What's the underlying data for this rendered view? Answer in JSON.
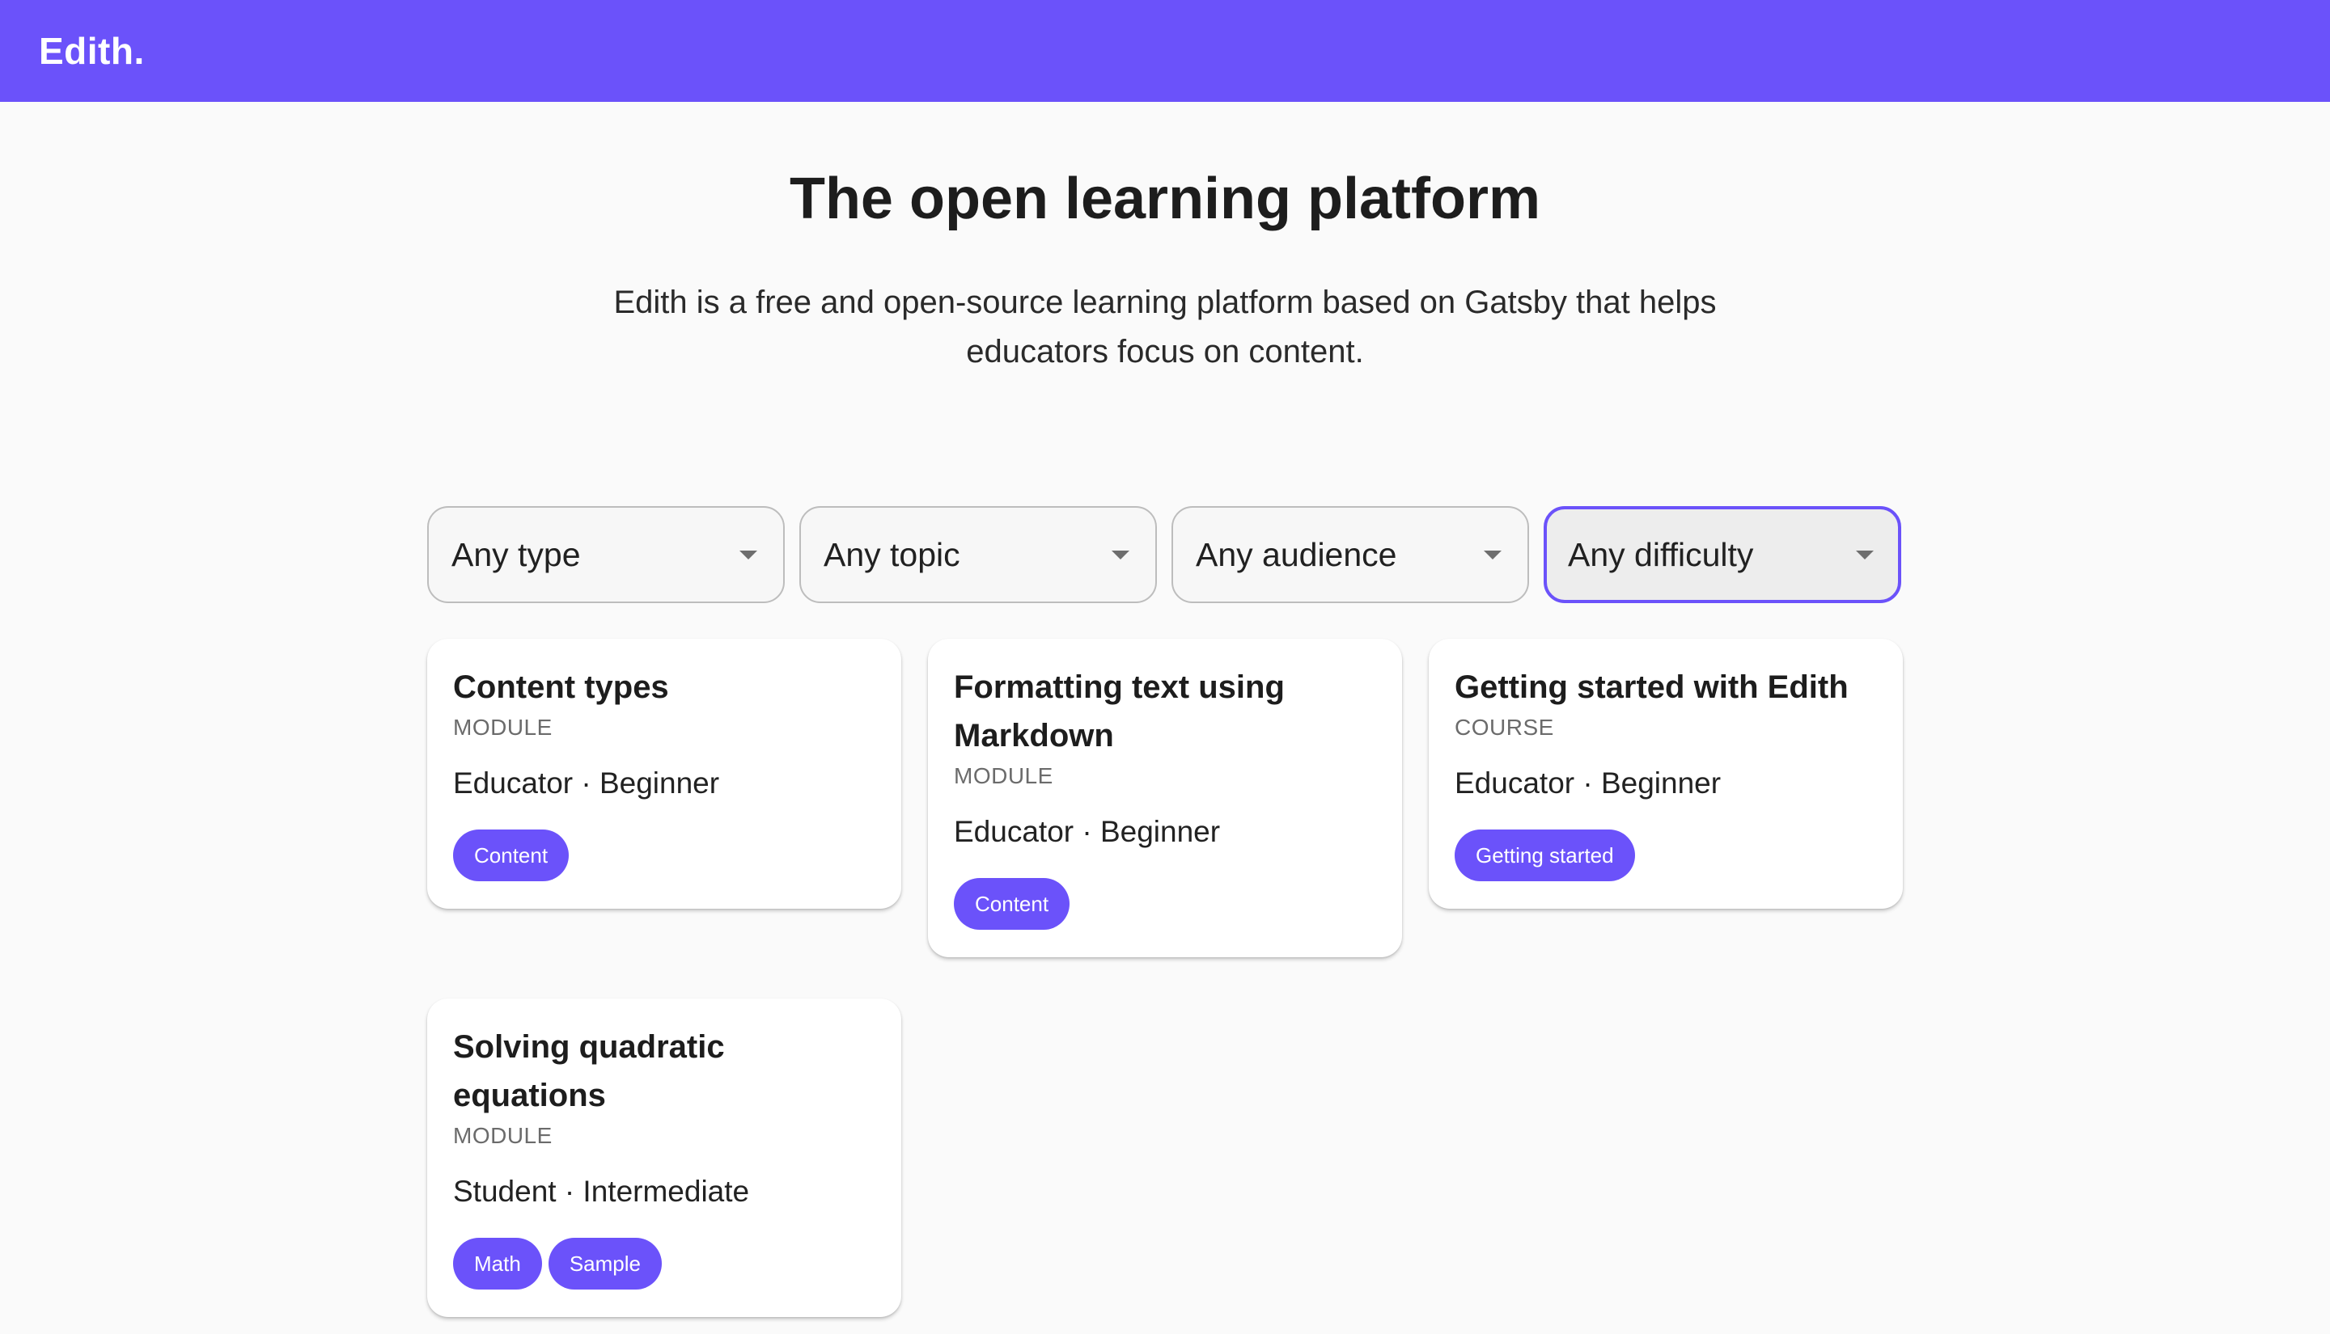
{
  "header": {
    "brand": "Edith."
  },
  "hero": {
    "title": "The open learning platform",
    "description": "Edith is a free and open-source learning platform based on Gatsby that helps educators focus on content."
  },
  "filters": [
    {
      "label": "Any type",
      "active": false
    },
    {
      "label": "Any topic",
      "active": false
    },
    {
      "label": "Any audience",
      "active": false
    },
    {
      "label": "Any difficulty",
      "active": true
    }
  ],
  "cards": [
    {
      "title": "Content types",
      "type": "MODULE",
      "meta": "Educator · Beginner",
      "tags": [
        "Content"
      ]
    },
    {
      "title": "Formatting text using Markdown",
      "type": "MODULE",
      "meta": "Educator · Beginner",
      "tags": [
        "Content"
      ]
    },
    {
      "title": "Getting started with Edith",
      "type": "COURSE",
      "meta": "Educator · Beginner",
      "tags": [
        "Getting started"
      ]
    },
    {
      "title": "Solving quadratic equations",
      "type": "MODULE",
      "meta": "Student · Intermediate",
      "tags": [
        "Math",
        "Sample"
      ]
    }
  ],
  "colors": {
    "accent": "#6b52fa",
    "background": "#fafafa"
  },
  "icons": {
    "filter_caret": "chevron-down-icon"
  }
}
